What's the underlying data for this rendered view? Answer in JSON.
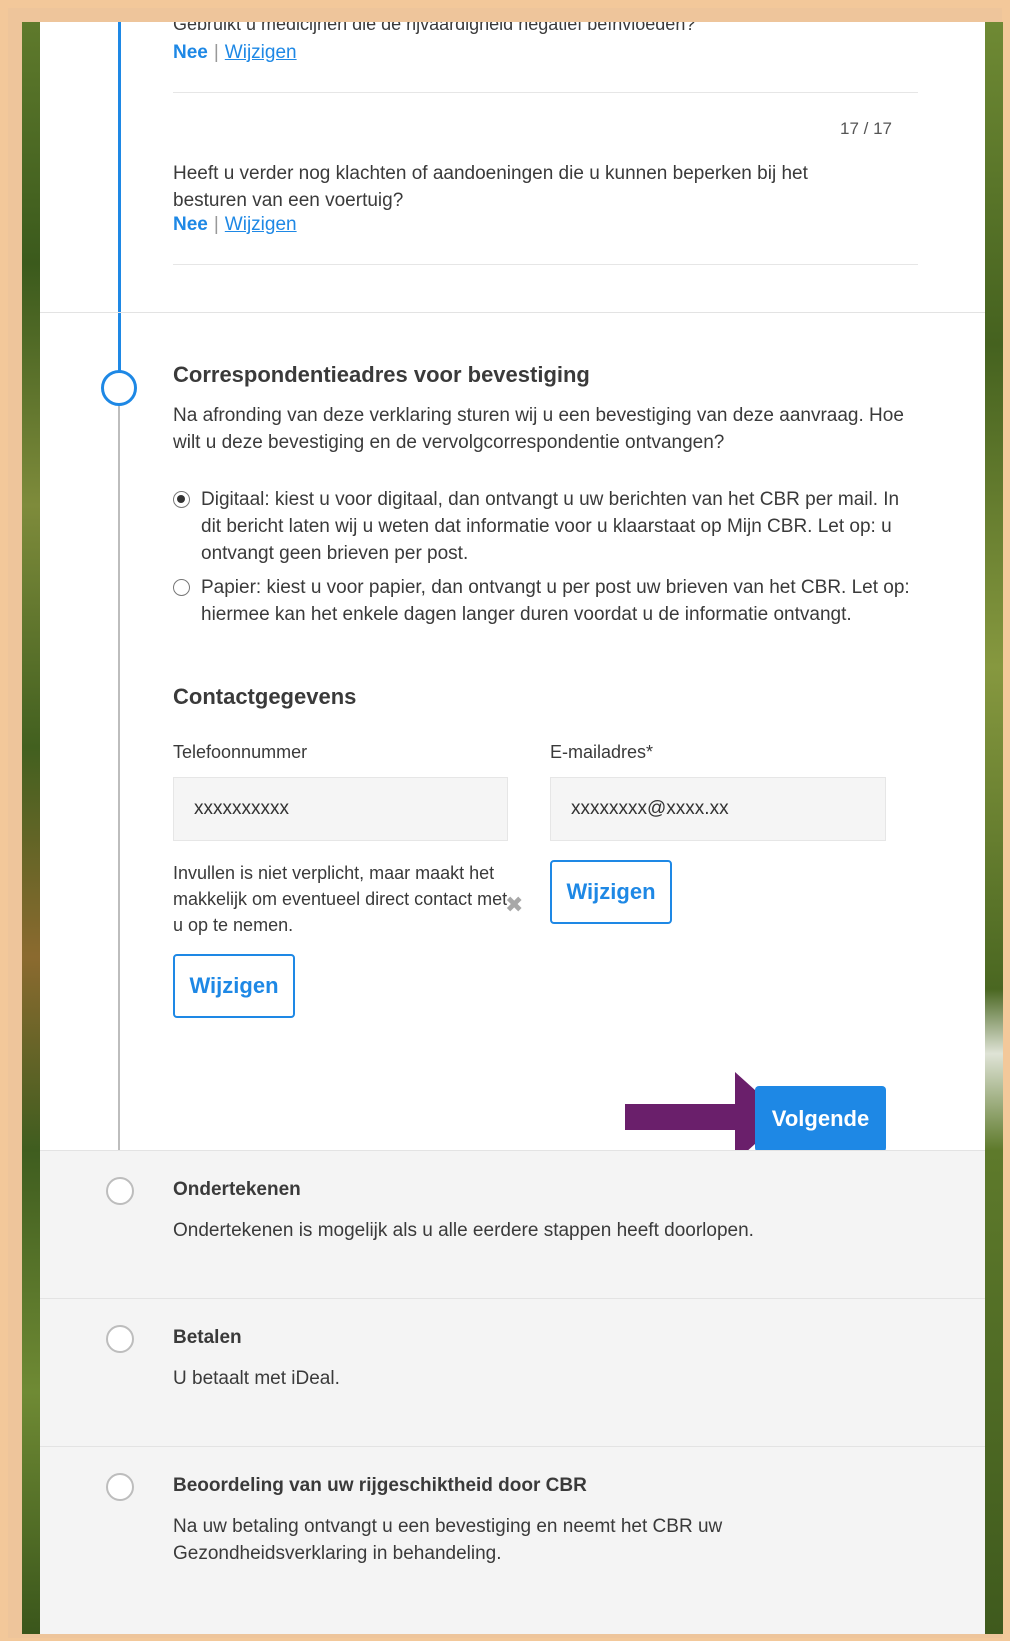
{
  "previous_questions": {
    "cut_question": "Gebruikt u medicijnen die de rijvaardigheid negatief beïnvloeden?",
    "answer1": "Nee",
    "change_link1": "Wijzigen",
    "counter": "17 / 17",
    "question": "Heeft u verder nog klachten of aandoeningen die u kunnen beperken bij het besturen van een voertuig?",
    "answer2": "Nee",
    "change_link2": "Wijzigen"
  },
  "correspondence": {
    "title": "Correspondentieadres voor bevestiging",
    "intro": "Na afronding van deze verklaring sturen wij u een bevestiging van deze aanvraag. Hoe wilt u deze bevestiging en de vervolgcorrespondentie ontvangen?",
    "option_digital": "Digitaal: kiest u voor digitaal, dan ontvangt u uw berichten van het CBR per mail. In dit bericht laten wij u weten dat informatie voor u klaarstaat op Mijn CBR. Let op: u ontvangt geen brieven per post.",
    "option_paper": "Papier: kiest u voor papier, dan ontvangt u per post uw brieven van het CBR. Let op: hiermee kan het enkele dagen langer duren voordat u de informatie ontvangt.",
    "selected": "digital"
  },
  "contact": {
    "title": "Contactgegevens",
    "phone_label": "Telefoonnummer",
    "phone_value": "xxxxxxxxxx",
    "email_label": "E-mailadres*",
    "email_value": "xxxxxxxx@xxxx.xx",
    "phone_hint": "Invullen is niet verplicht, maar maakt het makkelijk om eventueel direct contact met u op te nemen.",
    "change_phone": "Wijzigen",
    "change_email": "Wijzigen",
    "next_button": "Volgende"
  },
  "steps": [
    {
      "title": "Ondertekenen",
      "text": "Ondertekenen is mogelijk als u alle eerdere stappen heeft doorlopen."
    },
    {
      "title": "Betalen",
      "text": "U betaalt met iDeal."
    },
    {
      "title": "Beoordeling van uw rijgeschiktheid door CBR",
      "text": "Na uw betaling ontvangt u een bevestiging en neemt het CBR uw Gezondheidsverklaring in behandeling."
    }
  ],
  "colors": {
    "accent": "#1e88e5",
    "arrow": "#6a1f6b"
  }
}
